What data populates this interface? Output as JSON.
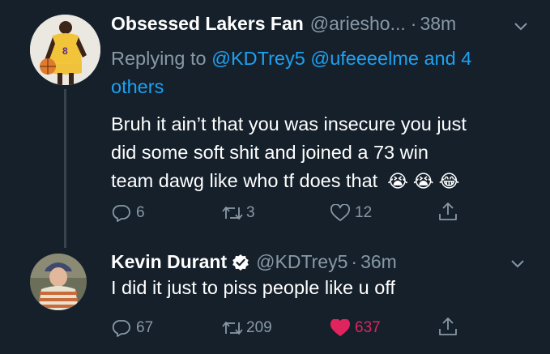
{
  "tweets": [
    {
      "display_name": "Obsessed Lakers Fan",
      "handle": "@ariesho...",
      "time": "38m",
      "reply_prefix": "Replying to ",
      "reply_mentions": "@KDTrey5 @ufeeeelme and 4",
      "reply_others": "others",
      "text_lines": [
        "Bruh it ain’t that you was insecure you just",
        "did some soft shit and joined a 73 win",
        "team dawg like who tf does that"
      ],
      "emoji": [
        "😭",
        "😭",
        "😂"
      ],
      "replies": "6",
      "retweets": "3",
      "likes": "12",
      "liked": false,
      "jersey_number": "8"
    },
    {
      "display_name": "Kevin Durant",
      "verified": true,
      "handle": "@KDTrey5",
      "time": "36m",
      "text_lines": [
        "I did it just to piss people like u off"
      ],
      "replies": "67",
      "retweets": "209",
      "likes": "637",
      "liked": true
    }
  ],
  "colors": {
    "background": "#15202b",
    "secondary_text": "#8899a6",
    "link": "#1da1f2",
    "like": "#e0245e"
  },
  "icons": [
    "reply-icon",
    "retweet-icon",
    "like-icon",
    "share-icon",
    "chevron-down-icon",
    "verified-icon"
  ]
}
